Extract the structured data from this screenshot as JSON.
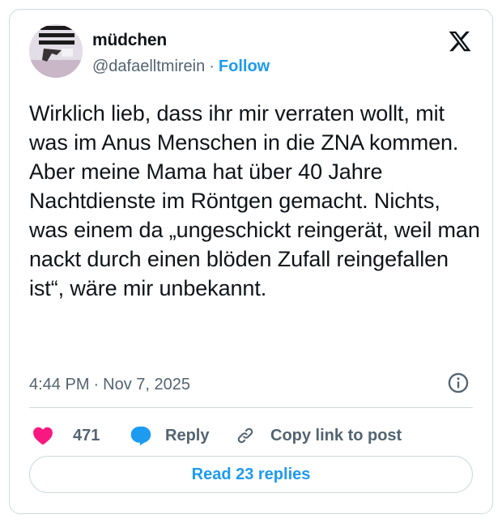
{
  "author": {
    "display_name": "müdchen",
    "handle": "@dafaelltmirein",
    "follow_label": "Follow"
  },
  "tweet": {
    "text": "Wirklich lieb, dass ihr mir verraten wollt, mit was im Anus Menschen in die ZNA kommen.\nAber meine Mama hat über 40 Jahre Nachtdienste im Röntgen gemacht. Nichts, was einem da „ungeschickt reingerät, weil man nackt durch einen blöden Zufall reingefallen ist“, wäre mir unbekannt.",
    "time": "4:44 PM",
    "date": "Nov 7, 2025"
  },
  "actions": {
    "like_count": "471",
    "reply_label": "Reply",
    "copy_label": "Copy link to post"
  },
  "read_replies_label": "Read 23 replies",
  "separator": "·",
  "icons": {
    "logo": "x-logo-icon",
    "info": "info-icon",
    "like": "heart-icon",
    "reply": "speech-bubble-icon",
    "copy": "link-icon"
  },
  "colors": {
    "accent": "#1d9bf0",
    "like": "#f91880",
    "secondary_text": "#536471",
    "border": "#cfd9de"
  }
}
